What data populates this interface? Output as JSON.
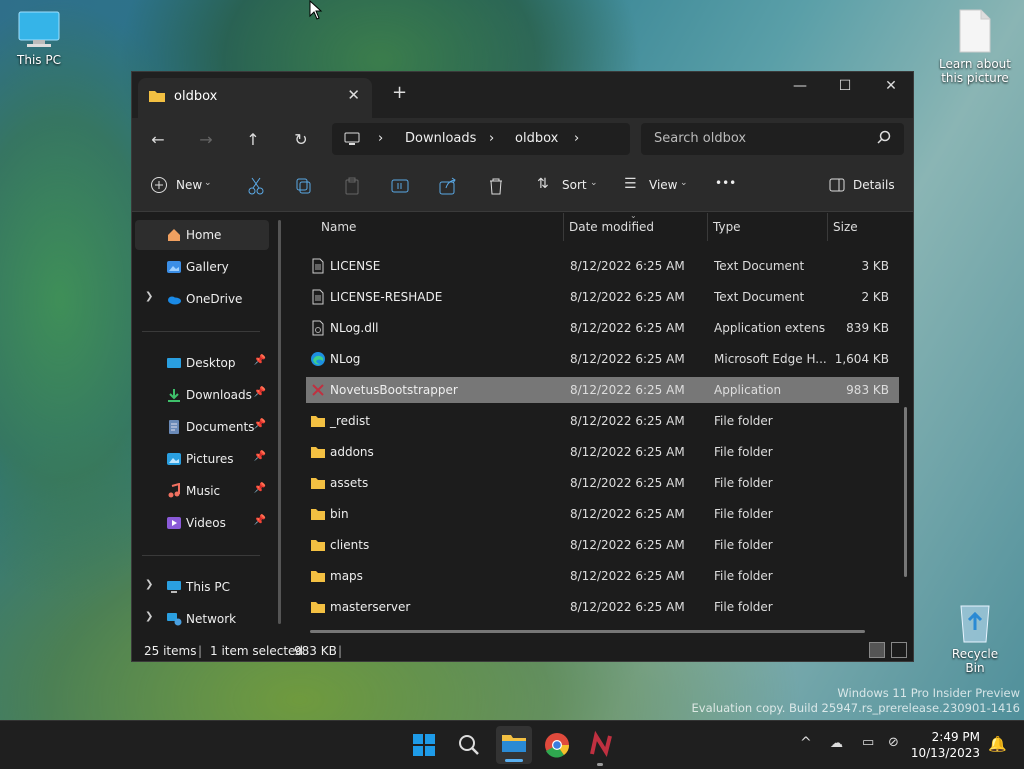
{
  "desktop": {
    "icons": [
      {
        "label": "This PC"
      },
      {
        "label": "Learn about this picture"
      },
      {
        "label": "Recycle Bin"
      }
    ],
    "watermark_line1": "Windows 11 Pro Insider Preview",
    "watermark_line2": "Evaluation copy. Build 25947.rs_prerelease.230901-1416"
  },
  "window": {
    "tab_title": "oldbox",
    "new_tab": "+",
    "controls": {
      "minimize": "—",
      "maximize": "☐",
      "close": "✕"
    },
    "address": {
      "segments": [
        "Downloads",
        "oldbox"
      ]
    },
    "search": {
      "placeholder": "Search oldbox"
    },
    "toolbar": {
      "new_label": "New",
      "sort_label": "Sort",
      "view_label": "View",
      "more_label": "•••",
      "details_label": "Details"
    },
    "sidebar": {
      "items": [
        {
          "label": "Home"
        },
        {
          "label": "Gallery"
        },
        {
          "label": "OneDrive"
        },
        {
          "label": "Desktop"
        },
        {
          "label": "Downloads"
        },
        {
          "label": "Documents"
        },
        {
          "label": "Pictures"
        },
        {
          "label": "Music"
        },
        {
          "label": "Videos"
        },
        {
          "label": "This PC"
        },
        {
          "label": "Network"
        }
      ]
    },
    "columns": {
      "name": "Name",
      "date": "Date modified",
      "type": "Type",
      "size": "Size"
    },
    "files": [
      {
        "name": "LICENSE",
        "date": "8/12/2022 6:25 AM",
        "type": "Text Document",
        "size": "3 KB"
      },
      {
        "name": "LICENSE-RESHADE",
        "date": "8/12/2022 6:25 AM",
        "type": "Text Document",
        "size": "2 KB"
      },
      {
        "name": "NLog.dll",
        "date": "8/12/2022 6:25 AM",
        "type": "Application extens...",
        "size": "839 KB"
      },
      {
        "name": "NLog",
        "date": "8/12/2022 6:25 AM",
        "type": "Microsoft Edge H...",
        "size": "1,604 KB"
      },
      {
        "name": "NovetusBootstrapper",
        "date": "8/12/2022 6:25 AM",
        "type": "Application",
        "size": "983 KB"
      },
      {
        "name": "_redist",
        "date": "8/12/2022 6:25 AM",
        "type": "File folder",
        "size": ""
      },
      {
        "name": "addons",
        "date": "8/12/2022 6:25 AM",
        "type": "File folder",
        "size": ""
      },
      {
        "name": "assets",
        "date": "8/12/2022 6:25 AM",
        "type": "File folder",
        "size": ""
      },
      {
        "name": "bin",
        "date": "8/12/2022 6:25 AM",
        "type": "File folder",
        "size": ""
      },
      {
        "name": "clients",
        "date": "8/12/2022 6:25 AM",
        "type": "File folder",
        "size": ""
      },
      {
        "name": "maps",
        "date": "8/12/2022 6:25 AM",
        "type": "File folder",
        "size": ""
      },
      {
        "name": "masterserver",
        "date": "8/12/2022 6:25 AM",
        "type": "File folder",
        "size": ""
      }
    ],
    "status": {
      "items": "25 items",
      "selected": "1 item selected",
      "size": "983 KB"
    }
  },
  "taskbar": {
    "time": "2:49 PM",
    "date": "10/13/2023",
    "tray_caret": "^"
  },
  "colors": {
    "accent": "#0078d4",
    "folder": "#f3c042",
    "selection": "#777777"
  }
}
